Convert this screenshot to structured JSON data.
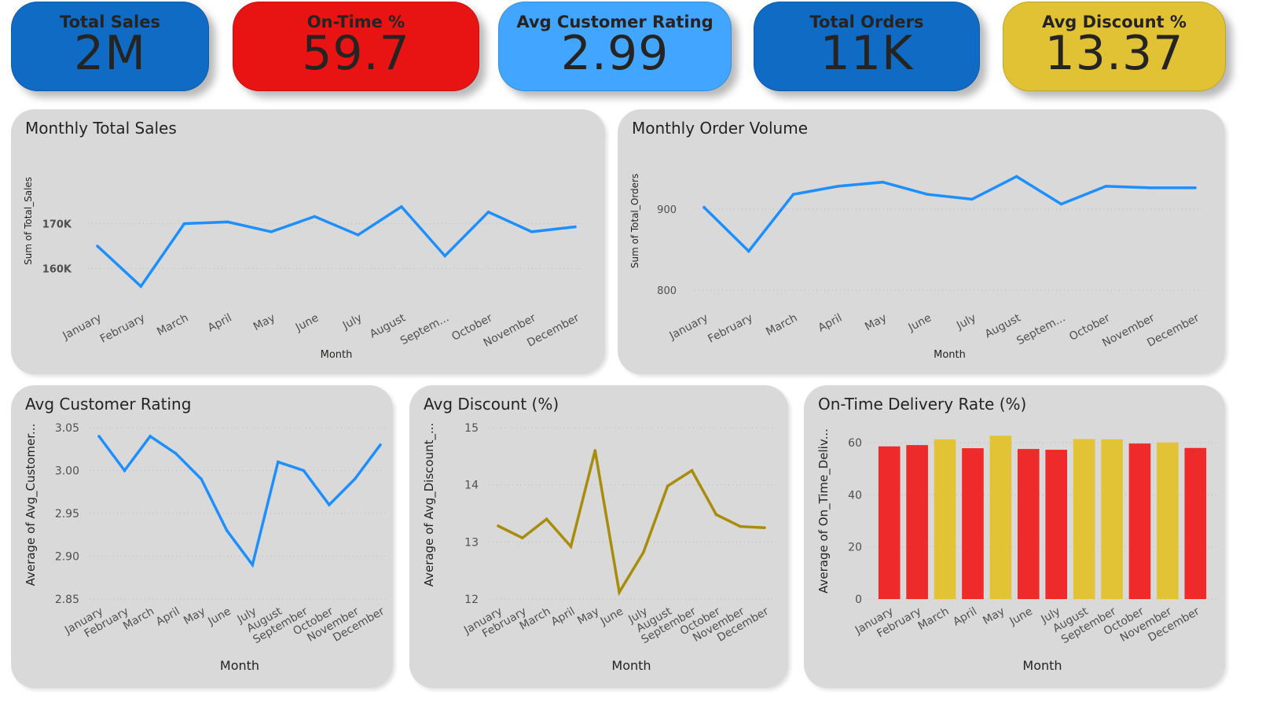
{
  "kpis": [
    {
      "title": "Total Sales",
      "value": "2M",
      "color": "#0f6bc4"
    },
    {
      "title": "On-Time %",
      "value": "59.7",
      "color": "#e81414"
    },
    {
      "title": "Avg Customer Rating",
      "value": "2.99",
      "color": "#42a5ff"
    },
    {
      "title": "Total Orders",
      "value": "11K",
      "color": "#0f6bc4"
    },
    {
      "title": "Avg Discount %",
      "value": "13.37",
      "color": "#e0c234"
    }
  ],
  "colors": {
    "line_blue": "#1e8fff",
    "line_olive": "#a88c0c",
    "bar_red": "#ee2a2a",
    "bar_yellow": "#e3c336",
    "panel_bg": "#d9d9d9"
  },
  "panels": {
    "sales": {
      "title": "Monthly Total Sales"
    },
    "orders": {
      "title": "Monthly Order Volume"
    },
    "rating": {
      "title": "Avg Customer Rating"
    },
    "discount": {
      "title": "Avg Discount (%)"
    },
    "ontime": {
      "title": "On-Time Delivery Rate (%)"
    }
  },
  "chart_data": [
    {
      "id": "sales",
      "type": "line",
      "title": "Monthly Total Sales",
      "xlabel": "Month",
      "ylabel": "Sum of Total_Sales",
      "categories": [
        "January",
        "February",
        "March",
        "April",
        "May",
        "June",
        "July",
        "August",
        "Septem...",
        "October",
        "November",
        "December"
      ],
      "values": [
        165000,
        156000,
        170000,
        170400,
        168200,
        171600,
        167500,
        173800,
        162800,
        172600,
        168200,
        169300
      ],
      "ylim": [
        152000,
        178000
      ],
      "yticks": [
        160000,
        170000
      ],
      "ytick_labels": [
        "160K",
        "170K"
      ],
      "color": "#1e8fff"
    },
    {
      "id": "orders",
      "type": "line",
      "title": "Monthly Order Volume",
      "xlabel": "Month",
      "ylabel": "Sum of Total_Orders",
      "categories": [
        "January",
        "February",
        "March",
        "April",
        "May",
        "June",
        "July",
        "August",
        "Septem...",
        "October",
        "November",
        "December"
      ],
      "values": [
        902,
        848,
        918,
        928,
        933,
        918,
        912,
        940,
        906,
        928,
        926,
        926
      ],
      "ylim": [
        800,
        955
      ],
      "yticks": [
        800,
        900
      ],
      "ytick_labels": [
        "800",
        "900"
      ],
      "color": "#1e8fff"
    },
    {
      "id": "rating",
      "type": "line",
      "title": "Avg Customer Rating",
      "xlabel": "Month",
      "ylabel": "Average of Avg_Customer...",
      "categories": [
        "January",
        "February",
        "March",
        "April",
        "May",
        "June",
        "July",
        "August",
        "September",
        "October",
        "November",
        "December"
      ],
      "values": [
        3.04,
        3.0,
        3.04,
        3.02,
        2.99,
        2.93,
        2.89,
        3.01,
        3.0,
        2.96,
        2.99,
        3.03
      ],
      "ylim": [
        2.85,
        3.05
      ],
      "yticks": [
        2.85,
        2.9,
        2.95,
        3.0,
        3.05
      ],
      "ytick_labels": [
        "2.85",
        "2.90",
        "2.95",
        "3.00",
        "3.05"
      ],
      "color": "#1e8fff"
    },
    {
      "id": "discount",
      "type": "line",
      "title": "Avg Discount (%)",
      "xlabel": "Month",
      "ylabel": "Average of Avg_Discount_...",
      "categories": [
        "January",
        "February",
        "March",
        "April",
        "May",
        "June",
        "July",
        "August",
        "September",
        "October",
        "November",
        "December"
      ],
      "values": [
        13.28,
        13.07,
        13.4,
        12.92,
        14.6,
        12.12,
        12.82,
        13.98,
        14.25,
        13.48,
        13.27,
        13.25
      ],
      "ylim": [
        12,
        15
      ],
      "yticks": [
        12,
        13,
        14,
        15
      ],
      "ytick_labels": [
        "12",
        "13",
        "14",
        "15"
      ],
      "color": "#a88c0c"
    },
    {
      "id": "ontime",
      "type": "bar",
      "title": "On-Time Delivery Rate (%)",
      "xlabel": "Month",
      "ylabel": "Average of On_Time_Deliv...",
      "categories": [
        "January",
        "February",
        "March",
        "April",
        "May",
        "June",
        "July",
        "August",
        "September",
        "October",
        "November",
        "December"
      ],
      "values": [
        58.6,
        59.1,
        61.3,
        57.9,
        62.7,
        57.6,
        57.3,
        61.4,
        61.3,
        59.7,
        60.1,
        58.0
      ],
      "bar_colors": [
        "#ee2a2a",
        "#ee2a2a",
        "#e3c336",
        "#ee2a2a",
        "#e3c336",
        "#ee2a2a",
        "#ee2a2a",
        "#e3c336",
        "#e3c336",
        "#ee2a2a",
        "#e3c336",
        "#ee2a2a"
      ],
      "ylim": [
        0,
        70
      ],
      "yticks": [
        0,
        20,
        40,
        60
      ],
      "ytick_labels": [
        "0",
        "20",
        "40",
        "60"
      ]
    }
  ]
}
